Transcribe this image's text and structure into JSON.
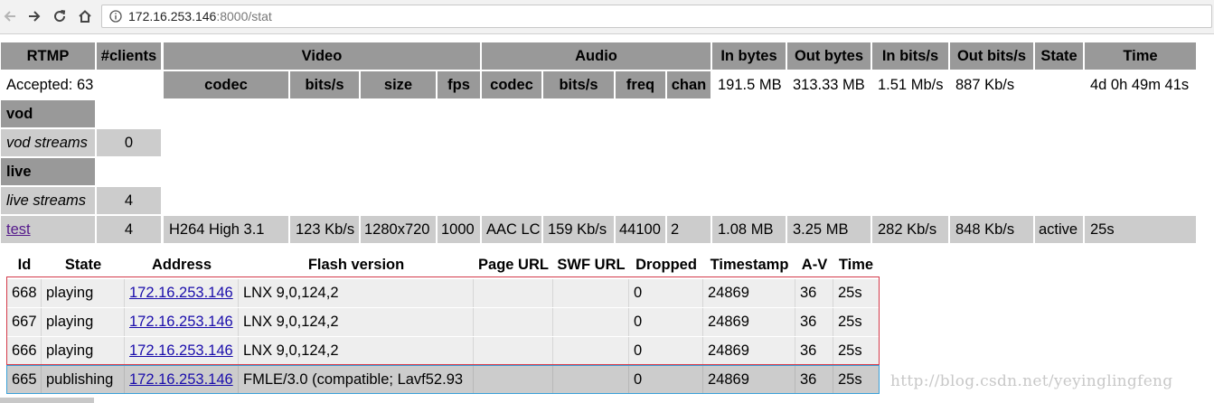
{
  "browser": {
    "url_host": "172.16.253.146",
    "url_rest": ":8000/stat"
  },
  "header": {
    "rtmp": "RTMP",
    "clients": "#clients",
    "video": "Video",
    "audio": "Audio",
    "in_bytes": "In bytes",
    "out_bytes": "Out bytes",
    "in_bits": "In bits/s",
    "out_bits": "Out bits/s",
    "state": "State",
    "time": "Time",
    "video_sub": [
      "codec",
      "bits/s",
      "size",
      "fps"
    ],
    "audio_sub": [
      "codec",
      "bits/s",
      "freq",
      "chan"
    ]
  },
  "summary": {
    "accepted": "Accepted: 63",
    "in_bytes": "191.5 MB",
    "out_bytes": "313.33 MB",
    "in_bits": "1.51 Mb/s",
    "out_bits": "887 Kb/s",
    "time": "4d 0h 49m 41s"
  },
  "vod": {
    "title": "vod",
    "streams_label": "vod streams",
    "count": "0"
  },
  "live": {
    "title": "live",
    "streams_label": "live streams",
    "count": "4"
  },
  "stream": {
    "name": "test",
    "clients": "4",
    "video_codec": "H264 High 3.1",
    "video_bits": "123 Kb/s",
    "video_size": "1280x720",
    "video_fps": "1000",
    "audio_codec": "AAC LC",
    "audio_bits": "159 Kb/s",
    "audio_freq": "44100",
    "audio_chan": "2",
    "in_bytes": "1.08 MB",
    "out_bytes": "3.25 MB",
    "in_bits": "282 Kb/s",
    "out_bits": "848 Kb/s",
    "state": "active",
    "time": "25s"
  },
  "clients_header": [
    "Id",
    "State",
    "Address",
    "Flash version",
    "Page URL",
    "SWF URL",
    "Dropped",
    "Timestamp",
    "A-V",
    "Time"
  ],
  "clients": [
    {
      "id": "668",
      "state": "playing",
      "address": "172.16.253.146",
      "flash": "LNX 9,0,124,2",
      "page_url": "",
      "swf_url": "",
      "dropped": "0",
      "timestamp": "24869",
      "av": "36",
      "time": "25s"
    },
    {
      "id": "667",
      "state": "playing",
      "address": "172.16.253.146",
      "flash": "LNX 9,0,124,2",
      "page_url": "",
      "swf_url": "",
      "dropped": "0",
      "timestamp": "24869",
      "av": "36",
      "time": "25s"
    },
    {
      "id": "666",
      "state": "playing",
      "address": "172.16.253.146",
      "flash": "LNX 9,0,124,2",
      "page_url": "",
      "swf_url": "",
      "dropped": "0",
      "timestamp": "24869",
      "av": "36",
      "time": "25s"
    },
    {
      "id": "665",
      "state": "publishing",
      "address": "172.16.253.146",
      "flash": "FMLE/3.0 (compatible; Lavf52.93",
      "page_url": "",
      "swf_url": "",
      "dropped": "0",
      "timestamp": "24869",
      "av": "36",
      "time": "25s"
    }
  ],
  "watermark": "http://blog.csdn.net/yeyinglingfeng",
  "colors": {
    "header_grey": "#999999",
    "row_grey": "#cccccc",
    "client_row": "#eeeeee",
    "link": "#1a0dab",
    "visited_link": "#551a8b",
    "playing_box": "#d43a4a",
    "publishing_box": "#3aa0d8"
  }
}
